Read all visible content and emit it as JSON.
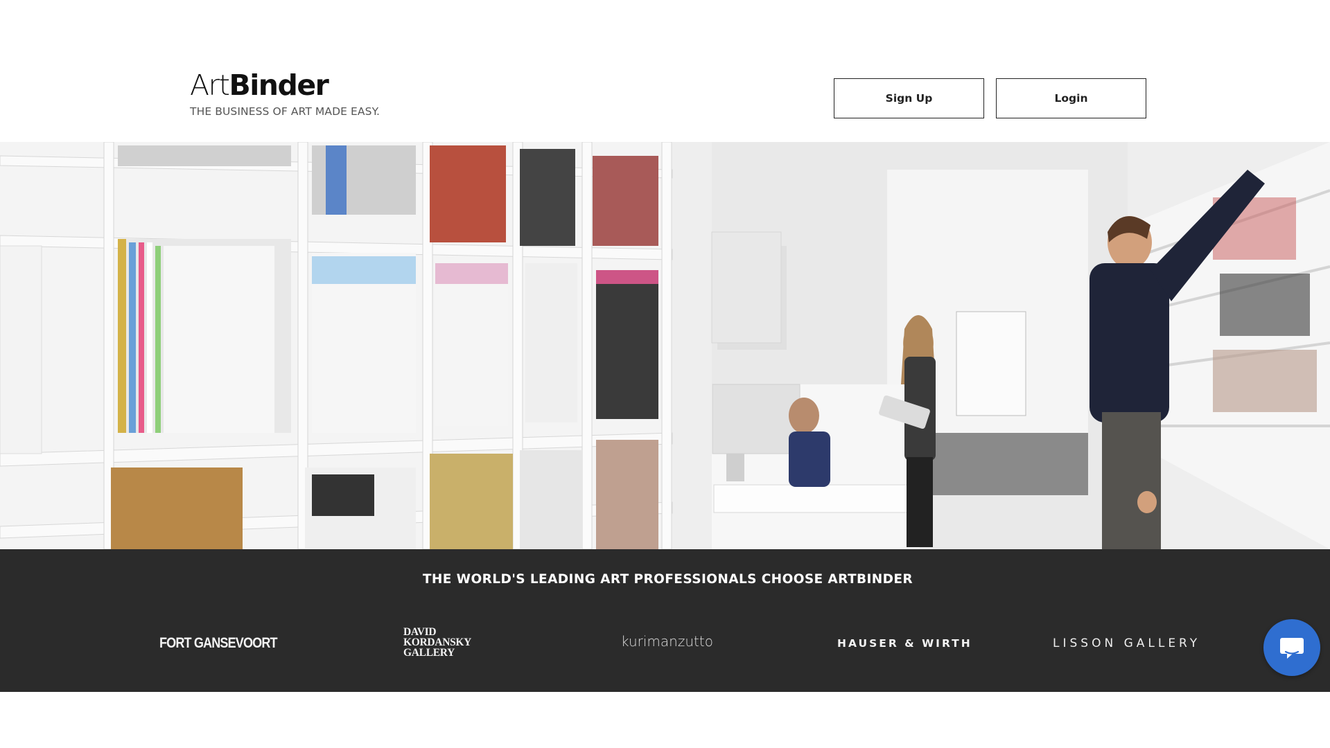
{
  "brand": {
    "logo_part1": "Art",
    "logo_part2": "Binder",
    "tagline": "THE BUSINESS OF ART MADE EASY."
  },
  "nav": {
    "signup_label": "Sign Up",
    "login_label": "Login"
  },
  "partners": {
    "heading": "THE WORLD'S LEADING ART PROFESSIONALS CHOOSE ARTBINDER",
    "logos": [
      {
        "name": "FORT GANSEVOORT"
      },
      {
        "name": "DAVID\nKORDANSKY\nGALLERY"
      },
      {
        "name": "kurimanzutto"
      },
      {
        "name": "HAUSER & WIRTH"
      },
      {
        "name": "LISSON GALLERY"
      }
    ]
  },
  "chat": {
    "icon": "chat-bubble-icon"
  },
  "colors": {
    "band_background": "#2b2b2b",
    "chat_button": "#2f6ed0",
    "button_border": "#222222"
  }
}
